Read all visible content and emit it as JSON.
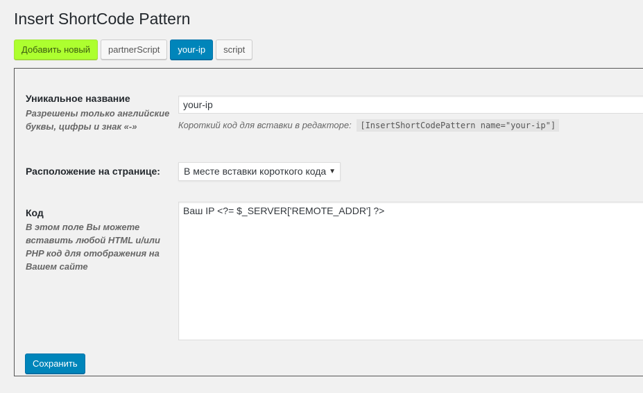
{
  "page": {
    "title": "Insert ShortCode Pattern"
  },
  "tabs": [
    {
      "label": "Добавить новый",
      "state": "add"
    },
    {
      "label": "partnerScript",
      "state": "normal"
    },
    {
      "label": "your-ip",
      "state": "active"
    },
    {
      "label": "script",
      "state": "normal"
    }
  ],
  "form": {
    "name": {
      "label": "Уникальное название",
      "description": "Разрешены только английские буквы, цифры и знак «-»",
      "value": "your-ip",
      "hint": "Короткий код для вставки в редакторе:",
      "shortcode": "[InsertShortCodePattern name=\"your-ip\"]"
    },
    "placement": {
      "label": "Расположение на странице:",
      "selected": "В месте вставки короткого кода"
    },
    "code": {
      "label": "Код",
      "description": "В этом поле Вы можете вставить любой HTML и/или PHP код для отображения на Вашем сайте",
      "value": "Ваш IP <?= $_SERVER['REMOTE_ADDR'] ?>"
    },
    "save_label": "Сохранить"
  },
  "colors": {
    "add_tab": "#adff2f",
    "active_tab": "#0085ba",
    "primary_button": "#0085ba"
  }
}
